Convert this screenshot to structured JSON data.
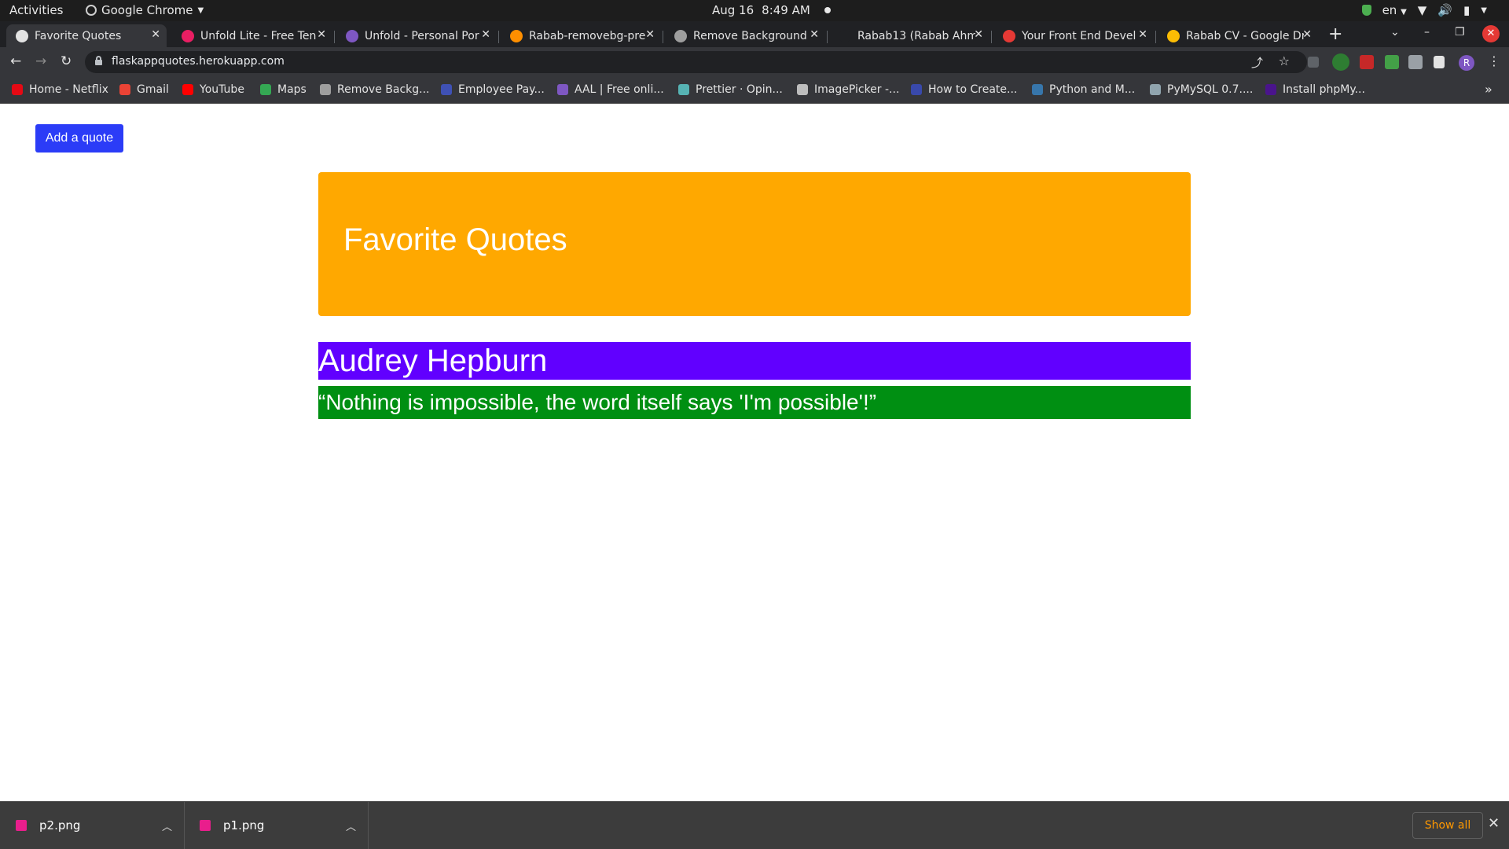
{
  "os_bar": {
    "activities": "Activities",
    "app_name": "Google Chrome",
    "date": "Aug 16",
    "time": "8:49 AM",
    "language": "en"
  },
  "tabs": [
    {
      "title": "Favorite Quotes",
      "favicon": "globe-icon",
      "color": "#e3e3e3",
      "active": true
    },
    {
      "title": "Unfold Lite - Free Ten",
      "favicon": "heart-icon",
      "color": "#e91e63"
    },
    {
      "title": "Unfold - Personal Por",
      "favicon": "gear-icon",
      "color": "#7e57c2"
    },
    {
      "title": "Rabab-removebg-pre",
      "favicon": "image-icon",
      "color": "#ff8f00"
    },
    {
      "title": "Remove Background",
      "favicon": "layers-icon",
      "color": "#9e9e9e"
    },
    {
      "title": "Rabab13 (Rabab Ahm",
      "favicon": "github-icon",
      "color": "#202124"
    },
    {
      "title": "Your Front End Devel",
      "favicon": "code-icon",
      "color": "#e53935"
    },
    {
      "title": "Rabab CV - Google Dr",
      "favicon": "drive-icon",
      "color": "#fbbc04"
    }
  ],
  "toolbar": {
    "url": "flaskappquotes.herokuapp.com",
    "profile_initial": "R"
  },
  "bookmarks": [
    {
      "label": "Home - Netflix",
      "icon": "netflix-icon",
      "color": "#e50914"
    },
    {
      "label": "Gmail",
      "icon": "gmail-icon",
      "color": "#ea4335"
    },
    {
      "label": "YouTube",
      "icon": "youtube-icon",
      "color": "#ff0000"
    },
    {
      "label": "Maps",
      "icon": "maps-icon",
      "color": "#34a853"
    },
    {
      "label": "Remove Backg...",
      "icon": "layers-icon",
      "color": "#9e9e9e"
    },
    {
      "label": "Employee Pay...",
      "icon": "book-icon",
      "color": "#3f51b5"
    },
    {
      "label": "AAL | Free onli...",
      "icon": "plane-icon",
      "color": "#7e57c2"
    },
    {
      "label": "Prettier · Opin...",
      "icon": "prettier-icon",
      "color": "#56b3b4"
    },
    {
      "label": "ImagePicker -...",
      "icon": "camera-icon",
      "color": "#bdbdbd"
    },
    {
      "label": "How to Create...",
      "icon": "a-icon",
      "color": "#3949ab"
    },
    {
      "label": "Python and M...",
      "icon": "python-icon",
      "color": "#3776ab"
    },
    {
      "label": "PyMySQL 0.7....",
      "icon": "doc-icon",
      "color": "#90a4ae"
    },
    {
      "label": "Install phpMy...",
      "icon": "php-icon",
      "color": "#4a148c"
    }
  ],
  "page": {
    "add_button": "Add a quote",
    "heading": "Favorite Quotes",
    "quotes": [
      {
        "author": "Audrey Hepburn",
        "text": "“Nothing is impossible, the word itself says 'I'm possible'!”"
      }
    ]
  },
  "downloads": {
    "files": [
      "p2.png",
      "p1.png"
    ],
    "show_all": "Show all"
  },
  "colors": {
    "add_button": "#2b3cf7",
    "jumbotron": "#ffa800",
    "author_bar": "#6100ff",
    "quote_bar": "#008f12",
    "show_all": "#ff9800"
  }
}
